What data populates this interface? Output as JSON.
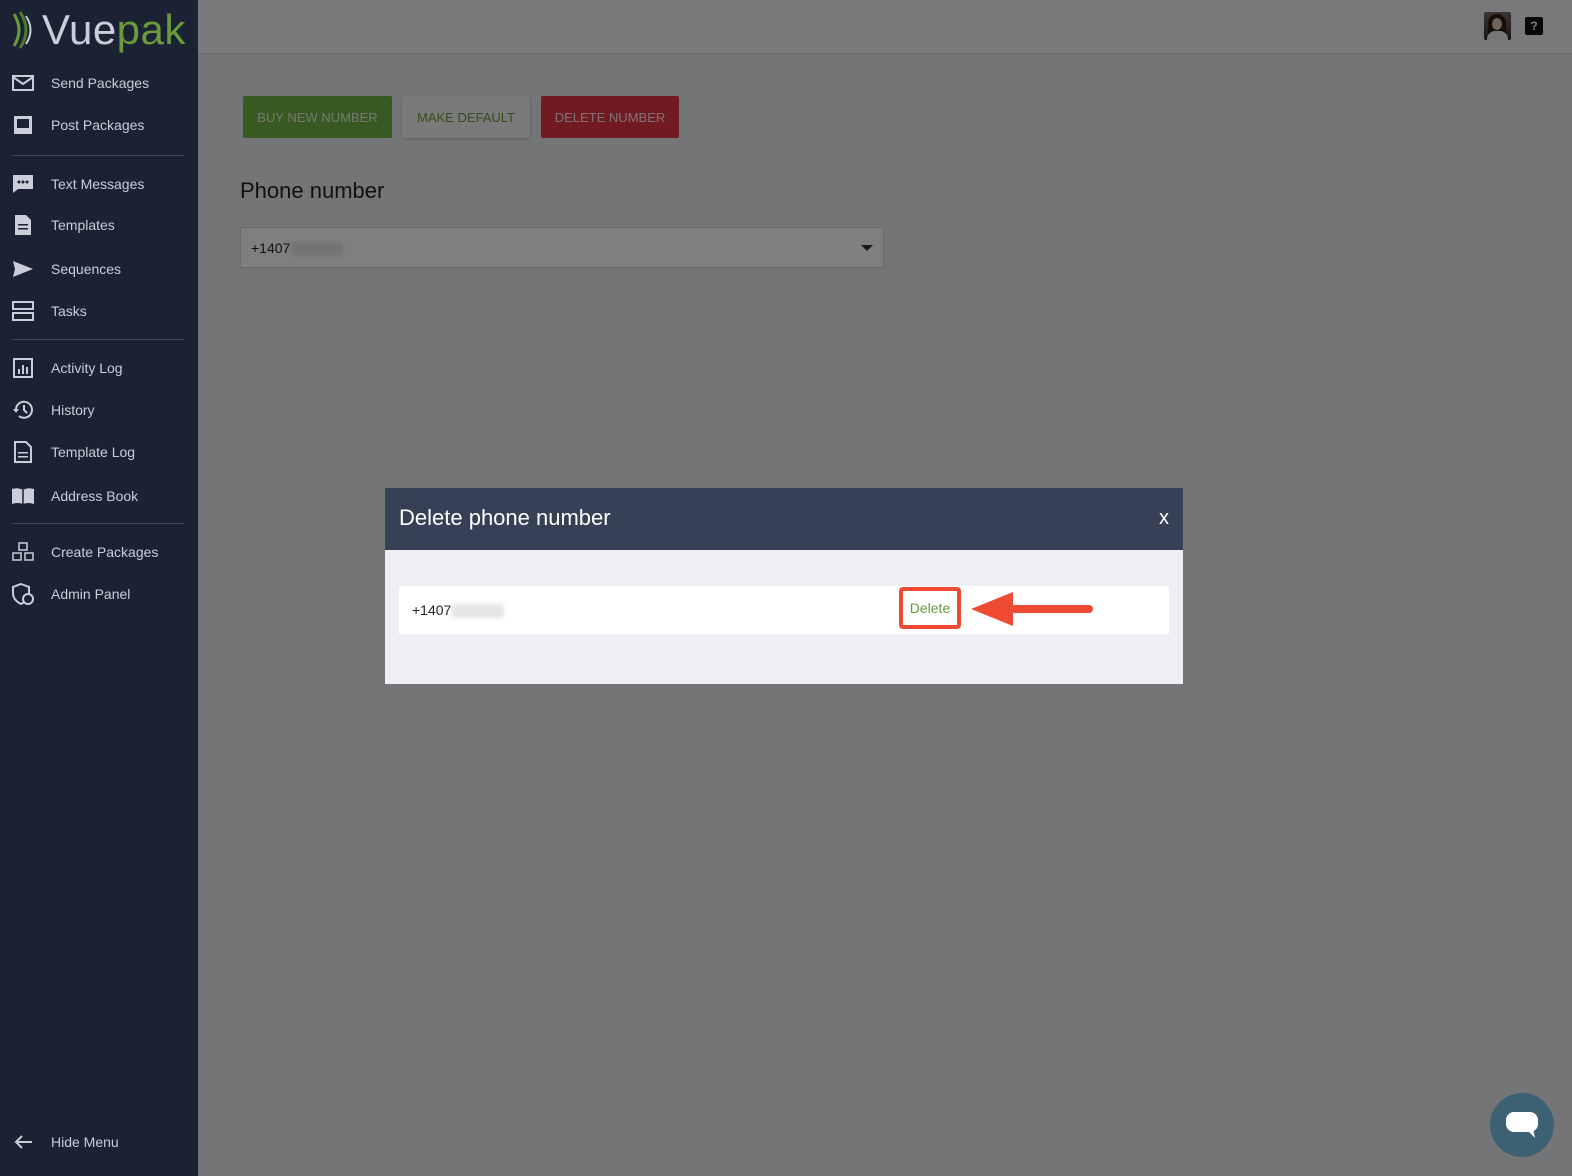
{
  "app": {
    "logo_part1": "Vue",
    "logo_part2": "pak"
  },
  "sidebar": {
    "items": [
      {
        "label": "Send Packages",
        "icon": "envelope-icon"
      },
      {
        "label": "Post Packages",
        "icon": "inbox-icon"
      },
      {
        "label": "Text Messages",
        "icon": "chat-icon"
      },
      {
        "label": "Templates",
        "icon": "document-icon"
      },
      {
        "label": "Sequences",
        "icon": "send-icon"
      },
      {
        "label": "Tasks",
        "icon": "tasks-icon"
      },
      {
        "label": "Activity Log",
        "icon": "chart-icon"
      },
      {
        "label": "History",
        "icon": "history-icon"
      },
      {
        "label": "Template Log",
        "icon": "document-icon"
      },
      {
        "label": "Address Book",
        "icon": "book-icon"
      },
      {
        "label": "Create Packages",
        "icon": "boxes-icon"
      },
      {
        "label": "Admin Panel",
        "icon": "shield-icon"
      }
    ],
    "hide_menu": "Hide Menu"
  },
  "topbar": {
    "help_label": "?"
  },
  "toolbar": {
    "buy_label": "BUY NEW NUMBER",
    "default_label": "MAKE DEFAULT",
    "delete_label": "DELETE NUMBER"
  },
  "phone": {
    "title": "Phone number",
    "selected_value": "+1407"
  },
  "modal": {
    "title": "Delete phone number",
    "close_label": "x",
    "row_number": "+1407",
    "delete_label": "Delete"
  },
  "colors": {
    "sidebar_bg": "#1b2234",
    "accent_green": "#70b244",
    "danger_red": "#e53545",
    "modal_header": "#364156",
    "highlight": "#ef4b34"
  }
}
